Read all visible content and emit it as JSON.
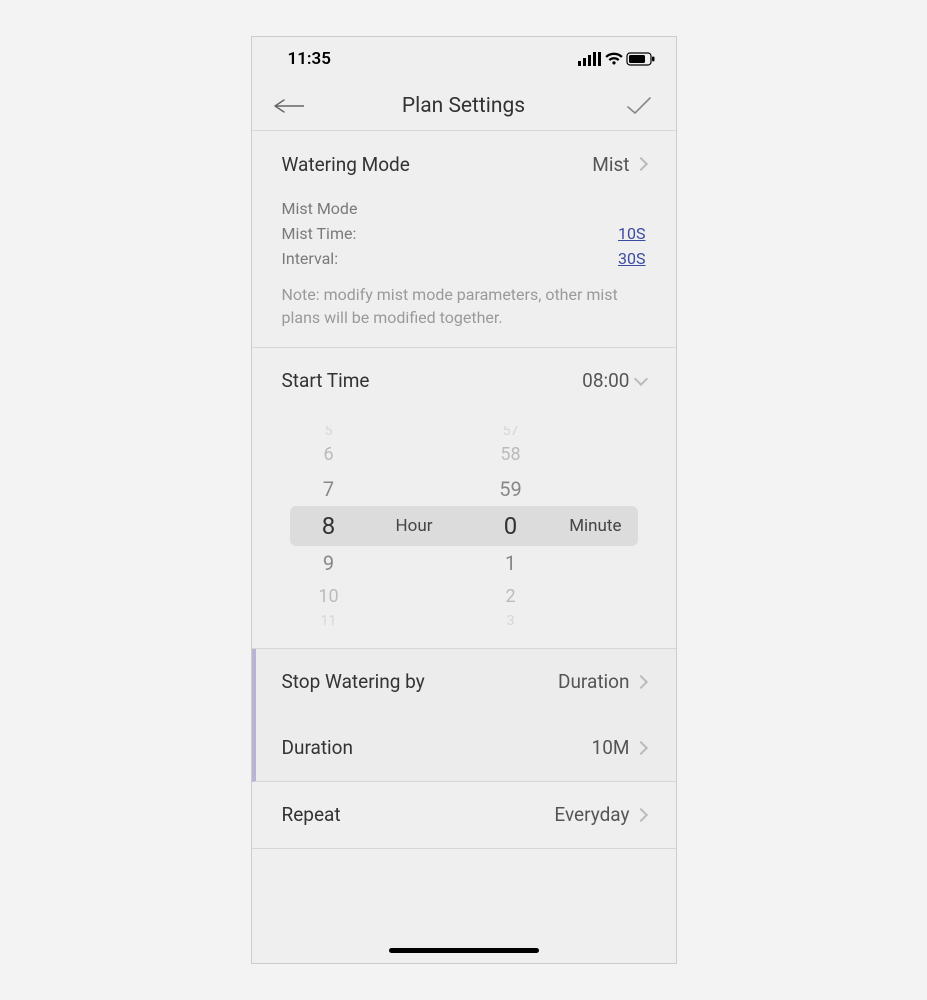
{
  "status": {
    "time": "11:35"
  },
  "nav": {
    "title": "Plan Settings"
  },
  "watering_mode": {
    "label": "Watering Mode",
    "value": "Mist",
    "mist_mode_label": "Mist Mode",
    "mist_time_label": "Mist Time:",
    "mist_time_value": "10S",
    "interval_label": "Interval:",
    "interval_value": "30S",
    "note": "Note: modify mist mode parameters, other mist plans will be modified together."
  },
  "start_time": {
    "label": "Start Time",
    "value": "08:00",
    "hour_label": "Hour",
    "minute_label": "Minute",
    "hours": {
      "m3": "5",
      "m2": "6",
      "m1": "7",
      "sel": "8",
      "p1": "9",
      "p2": "10",
      "p3": "11"
    },
    "minutes": {
      "m3": "57",
      "m2": "58",
      "m1": "59",
      "sel": "0",
      "p1": "1",
      "p2": "2",
      "p3": "3"
    }
  },
  "stop_by": {
    "label": "Stop Watering by",
    "value": "Duration"
  },
  "duration": {
    "label": "Duration",
    "value": "10M"
  },
  "repeat": {
    "label": "Repeat",
    "value": "Everyday"
  }
}
